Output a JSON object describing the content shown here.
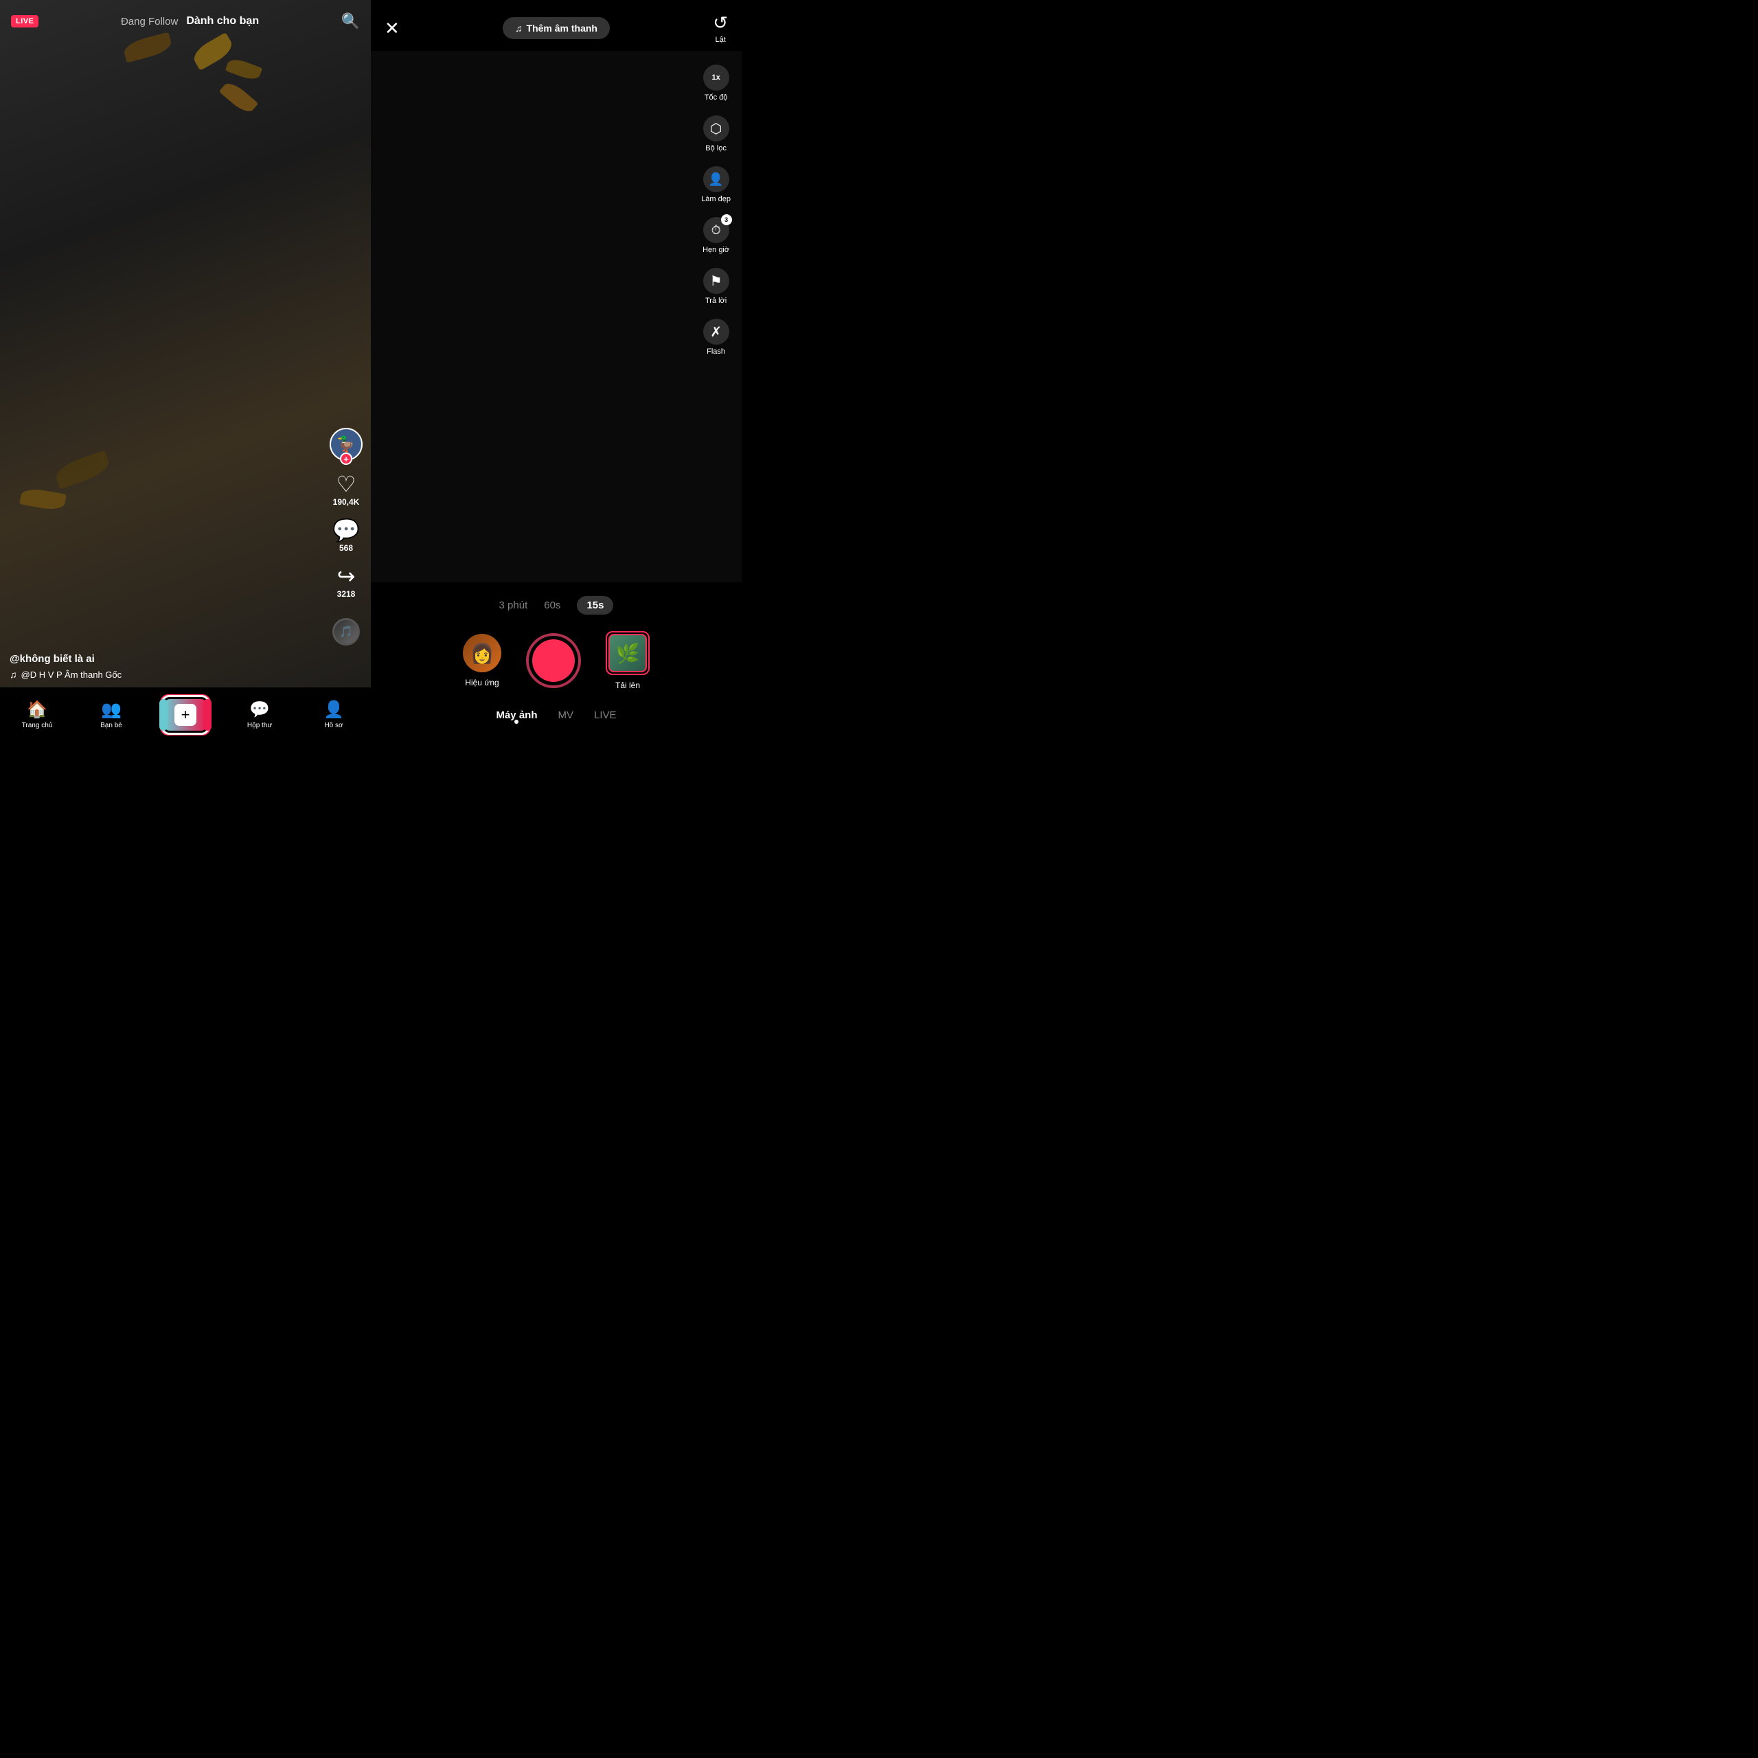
{
  "left": {
    "live_badge": "LIVE",
    "tab_follow": "Đang Follow",
    "tab_for_you": "Dành cho bạn",
    "search_icon": "🔍",
    "like_count": "190,4K",
    "comment_count": "568",
    "share_count": "3218",
    "username": "@không biết là ai",
    "music_note": "♫",
    "music_info": "@D H V P Âm thanh Gốc",
    "nav": {
      "home_icon": "🏠",
      "home_label": "Trang chủ",
      "friends_icon": "👥",
      "friends_label": "Bạn bè",
      "plus_icon": "+",
      "inbox_icon": "💬",
      "inbox_label": "Hộp thư",
      "profile_icon": "👤",
      "profile_label": "Hồ sơ"
    }
  },
  "right": {
    "close_icon": "✕",
    "add_sound_label": "Thêm âm thanh",
    "refresh_label": "Lật",
    "tools": [
      {
        "icon": "1x",
        "label": "Tốc độ",
        "type": "speed"
      },
      {
        "icon": "⚙",
        "label": "Bộ lọc",
        "type": "filter"
      },
      {
        "icon": "✨",
        "label": "Làm đẹp",
        "type": "beauty"
      },
      {
        "icon": "⏱",
        "label": "Hẹn giờ",
        "type": "timer"
      },
      {
        "icon": "↩",
        "label": "Trả lời",
        "type": "reply"
      },
      {
        "icon": "⚡",
        "label": "Flash",
        "type": "flash"
      }
    ],
    "durations": [
      "3 phút",
      "60s",
      "15s"
    ],
    "active_duration": "15s",
    "effect_label": "Hiệu ứng",
    "upload_label": "Tải lên",
    "modes": [
      "Máy ảnh",
      "MV",
      "LIVE"
    ],
    "active_mode": "Máy ảnh"
  }
}
